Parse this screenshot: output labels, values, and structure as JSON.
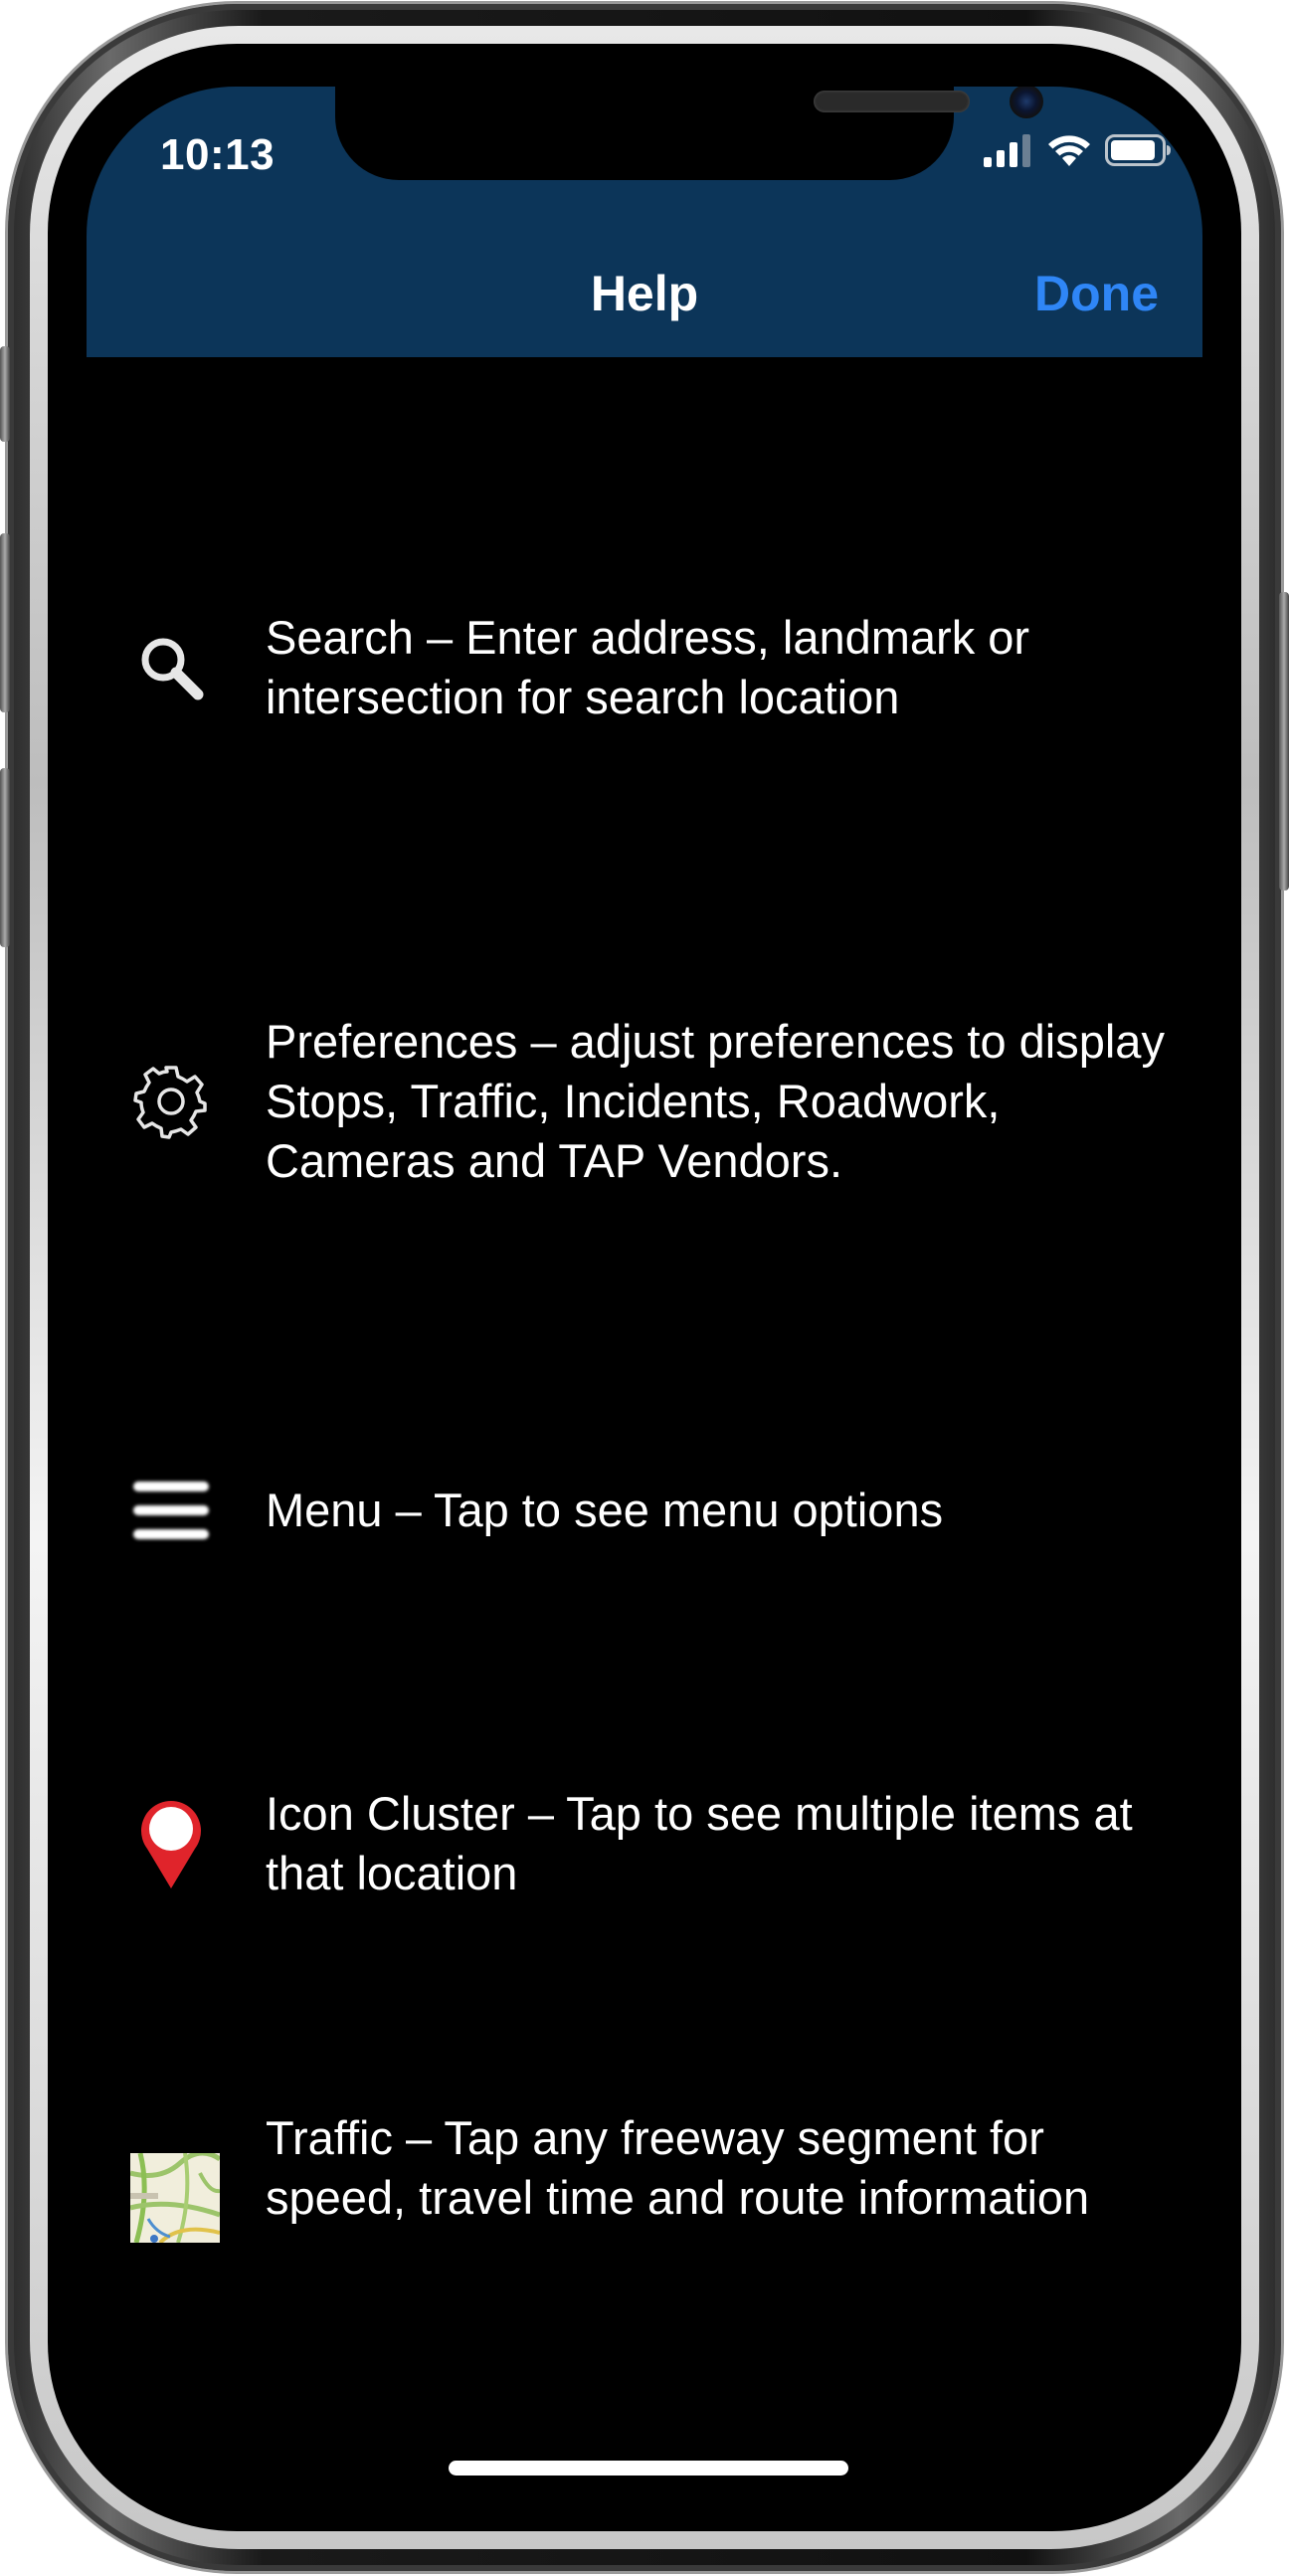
{
  "status_bar": {
    "time": "10:13",
    "signal_icon": "cellular-signal-icon",
    "wifi_icon": "wifi-icon",
    "battery_icon": "battery-icon"
  },
  "navbar": {
    "title": "Help",
    "done_label": "Done"
  },
  "help_items": [
    {
      "icon": "search-icon",
      "text": "Search – Enter address, landmark or intersection for search location"
    },
    {
      "icon": "gear-icon",
      "text": "Preferences – adjust preferences to display Stops, Traffic, Incidents, Roadwork, Cameras and TAP Vendors."
    },
    {
      "icon": "menu-icon",
      "text": "Menu – Tap to see menu options"
    },
    {
      "icon": "map-pin-icon",
      "text": "Icon Cluster – Tap to see multiple items at that location"
    },
    {
      "icon": "traffic-map-icon",
      "text": "Traffic – Tap any freeway segment for speed, travel time and route information"
    }
  ],
  "colors": {
    "navbar_background": "#0c3559",
    "done_accent": "#2f86f6",
    "pin_red": "#e0242b"
  }
}
